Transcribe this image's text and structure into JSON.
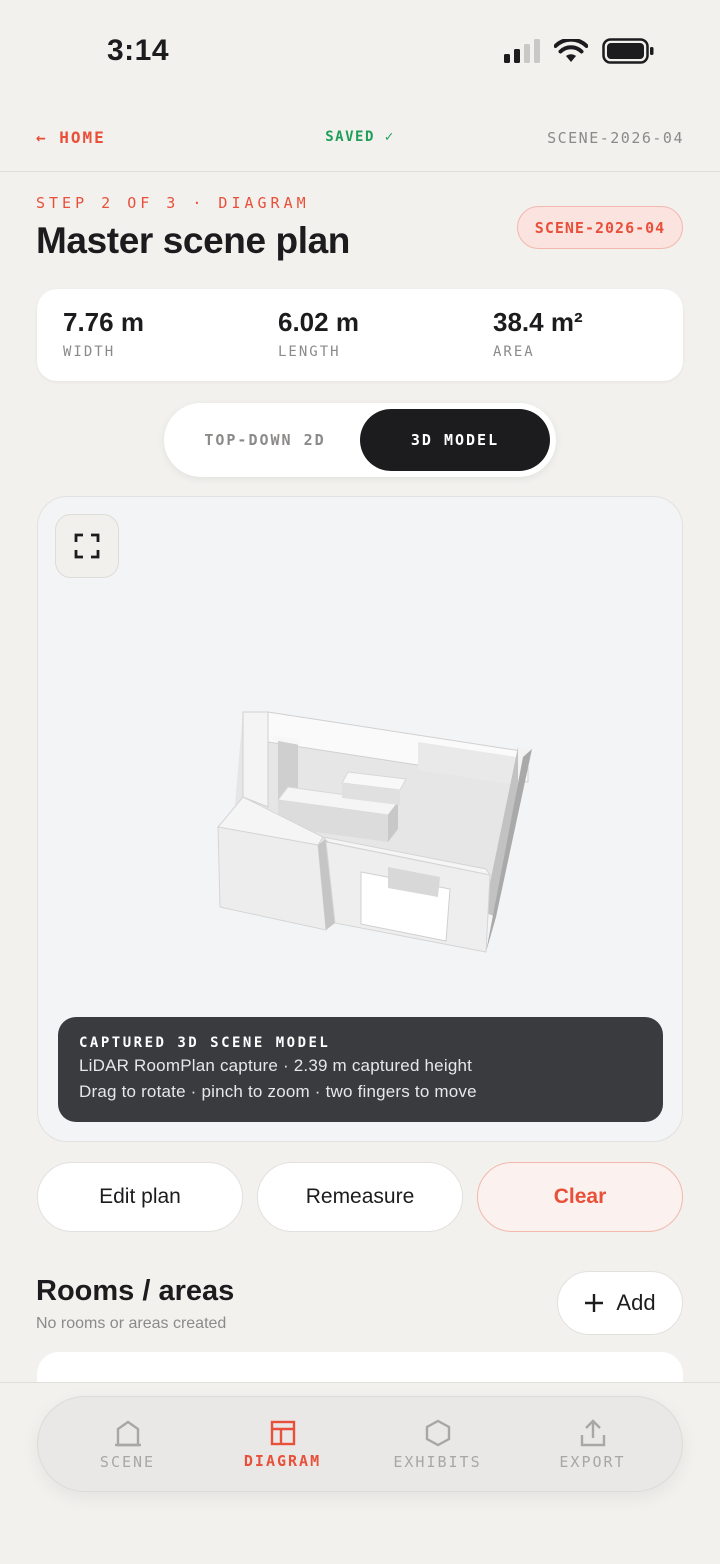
{
  "status": {
    "time": "3:14"
  },
  "nav": {
    "home": "← HOME",
    "saved": "SAVED ✓",
    "scene_id": "SCENE-2026-04"
  },
  "header": {
    "step": "STEP 2 OF 3 · DIAGRAM",
    "title": "Master scene plan",
    "badge": "SCENE-2026-04"
  },
  "measurements": [
    {
      "value": "7.76 m",
      "label": "WIDTH"
    },
    {
      "value": "6.02 m",
      "label": "LENGTH"
    },
    {
      "value": "38.4 m²",
      "label": "AREA"
    }
  ],
  "view_toggle": {
    "option_2d": "TOP-DOWN 2D",
    "option_3d": "3D MODEL",
    "selected": "3D MODEL"
  },
  "viewer": {
    "caption_title": "CAPTURED 3D SCENE MODEL",
    "caption_line1": "LiDAR RoomPlan capture · 2.39 m captured height",
    "caption_line2": "Drag to rotate · pinch to zoom · two fingers to move"
  },
  "actions": {
    "edit": "Edit plan",
    "remeasure": "Remeasure",
    "clear": "Clear"
  },
  "rooms": {
    "title": "Rooms / areas",
    "subtitle": "No rooms or areas created",
    "add": "Add"
  },
  "tabs": [
    {
      "label": "SCENE",
      "icon": "house-icon",
      "active": false
    },
    {
      "label": "DIAGRAM",
      "icon": "layout-icon",
      "active": true
    },
    {
      "label": "EXHIBITS",
      "icon": "hexagon-icon",
      "active": false
    },
    {
      "label": "EXPORT",
      "icon": "upload-icon",
      "active": false
    }
  ],
  "colors": {
    "accent": "#e8503a",
    "saved": "#1e9e5a",
    "dark": "#1c1c1e",
    "background": "#f2f1ee"
  }
}
